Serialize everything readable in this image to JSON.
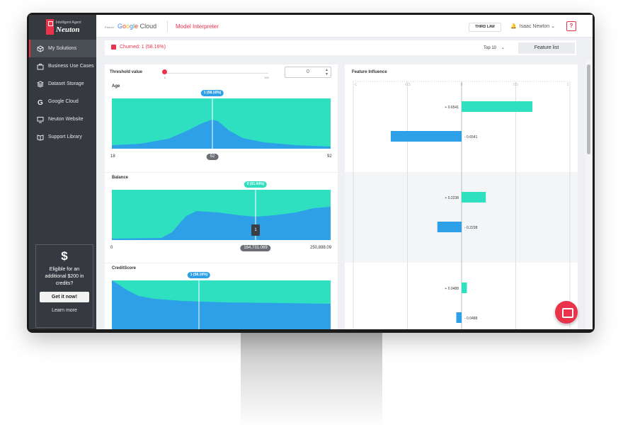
{
  "brand": {
    "small": "Intelligent Agent",
    "name": "Neuton"
  },
  "sidebar": {
    "items": [
      {
        "label": "My Solutions",
        "icon": "cube-icon",
        "active": true
      },
      {
        "label": "Business Use Cases",
        "icon": "briefcase-icon",
        "active": false
      },
      {
        "label": "Dataset Storage",
        "icon": "layers-icon",
        "active": false
      },
      {
        "label": "Google Cloud",
        "icon": "google-icon",
        "active": false
      },
      {
        "label": "Neuton Website",
        "icon": "monitor-icon",
        "active": false
      },
      {
        "label": "Support Library",
        "icon": "book-icon",
        "active": false
      }
    ],
    "credit": {
      "icon": "$",
      "text": "Eligible for an additional $200 in credits?",
      "button": "Get it now!",
      "link": "Learn more"
    }
  },
  "topbar": {
    "partner": "Partner",
    "google": [
      "G",
      "o",
      "o",
      "g",
      "l",
      "e"
    ],
    "cloud": " Cloud",
    "title": "Model Interpreter",
    "third_law": "THIRD LAW",
    "user": "Isaac Newton",
    "help": "?"
  },
  "status": {
    "churned": "Churned: 1 (58.16%)",
    "top": "Top 10",
    "feature_list": "Feature list"
  },
  "threshold": {
    "label": "Threshold value",
    "value": "0",
    "min": "0",
    "max": "100"
  },
  "features": [
    {
      "name": "Age",
      "bubble": "1 (58.16%)",
      "bubble_color": "#2ea0e8",
      "min": "18",
      "marker": "52",
      "max": "92",
      "marker_frac": 0.46
    },
    {
      "name": "Balance",
      "bubble": "0 (51.44%)",
      "bubble_color": "#2fe0c0",
      "min": "0",
      "marker": "164,731.069",
      "max": "250,898.09",
      "marker_frac": 0.656,
      "tooltip": "1"
    },
    {
      "name": "CreditScore",
      "bubble": "1 (58.16%)",
      "bubble_color": "#2ea0e8",
      "marker_frac": 0.4
    }
  ],
  "influence": {
    "title": "Feature Influence",
    "ticks": [
      "-1",
      "-0.5",
      "0",
      "0.5",
      "1"
    ],
    "domain": [
      -1,
      1
    ],
    "rows": [
      {
        "pos_label": "+ 0.6541",
        "neg_label": "- 0.6541",
        "value": 0.6541
      },
      {
        "pos_label": "+ 0.2238",
        "neg_label": "- 0.2238",
        "value": 0.2238
      },
      {
        "pos_label": "+ 0.0488",
        "neg_label": "- 0.0488",
        "value": 0.0488
      }
    ]
  },
  "colors": {
    "teal": "#2fe0c0",
    "blue": "#2ea0e8",
    "accent": "#e8334a"
  }
}
